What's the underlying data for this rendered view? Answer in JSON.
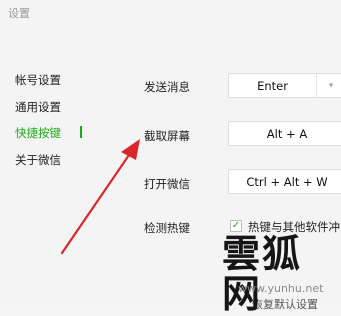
{
  "window": {
    "title": "设置"
  },
  "sidebar": {
    "items": [
      {
        "label": "帐号设置"
      },
      {
        "label": "通用设置"
      },
      {
        "label": "快捷按键",
        "active": true
      },
      {
        "label": "关于微信"
      }
    ]
  },
  "shortcuts": {
    "rows": [
      {
        "label": "发送消息",
        "value": "Enter"
      },
      {
        "label": "截取屏幕",
        "value": "Alt + A"
      },
      {
        "label": "打开微信",
        "value": "Ctrl + Alt + W"
      },
      {
        "label": "检测热键"
      }
    ],
    "conflict_checkbox": {
      "label": "热键与其他软件冲",
      "checked": true
    },
    "bottom_button": "恢复默认设置"
  },
  "watermark": {
    "logo_text": "雲狐网",
    "url": "www.yunhu.net"
  },
  "colors": {
    "accent": "#1aad19",
    "arrow": "#d9262b"
  }
}
